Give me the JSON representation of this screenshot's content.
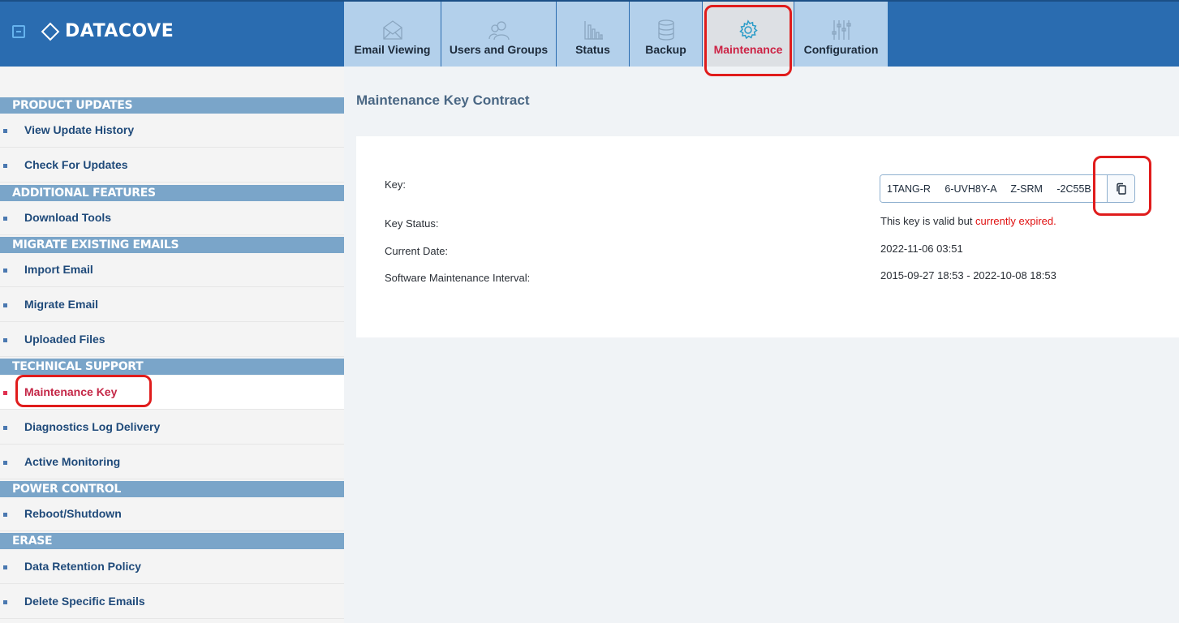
{
  "app": {
    "logo_text": "DATACOVE"
  },
  "tabs": [
    {
      "label": "Email Viewing",
      "icon": "envelope-icon"
    },
    {
      "label": "Users and Groups",
      "icon": "users-icon"
    },
    {
      "label": "Status",
      "icon": "bar-chart-icon"
    },
    {
      "label": "Backup",
      "icon": "database-icon"
    },
    {
      "label": "Maintenance",
      "icon": "gear-icon",
      "active": true
    },
    {
      "label": "Configuration",
      "icon": "sliders-icon"
    }
  ],
  "sidebar": {
    "sections": [
      {
        "title": "PRODUCT UPDATES",
        "items": [
          "View Update History",
          "Check For Updates"
        ]
      },
      {
        "title": "ADDITIONAL FEATURES",
        "items": [
          "Download Tools"
        ]
      },
      {
        "title": "MIGRATE EXISTING EMAILS",
        "items": [
          "Import Email",
          "Migrate Email",
          "Uploaded Files"
        ]
      },
      {
        "title": "TECHNICAL SUPPORT",
        "items": [
          "Maintenance Key",
          "Diagnostics Log Delivery",
          "Active Monitoring"
        ]
      },
      {
        "title": "POWER CONTROL",
        "items": [
          "Reboot/Shutdown"
        ]
      },
      {
        "title": "ERASE",
        "items": [
          "Data Retention Policy",
          "Delete Specific Emails"
        ]
      }
    ],
    "active_item": "Maintenance Key"
  },
  "main": {
    "title": "Maintenance Key Contract",
    "key_label": "Key:",
    "key_value": "1TANG-R 6-UVH8Y-A Z-SRM -2C55B",
    "status_label": "Key Status:",
    "status_text": "This key is valid but ",
    "status_expired": "currently expired.",
    "date_label": "Current Date:",
    "date_value": "2022-11-06 03:51",
    "interval_label": "Software Maintenance Interval:",
    "interval_value": "2015-09-27 18:53 - 2022-10-08 18:53"
  },
  "colors": {
    "header": "#2a6cb0",
    "tab": "#b3d0eb",
    "section": "#7aa5c9",
    "active": "#c42646",
    "annotation": "#e01c1c"
  }
}
